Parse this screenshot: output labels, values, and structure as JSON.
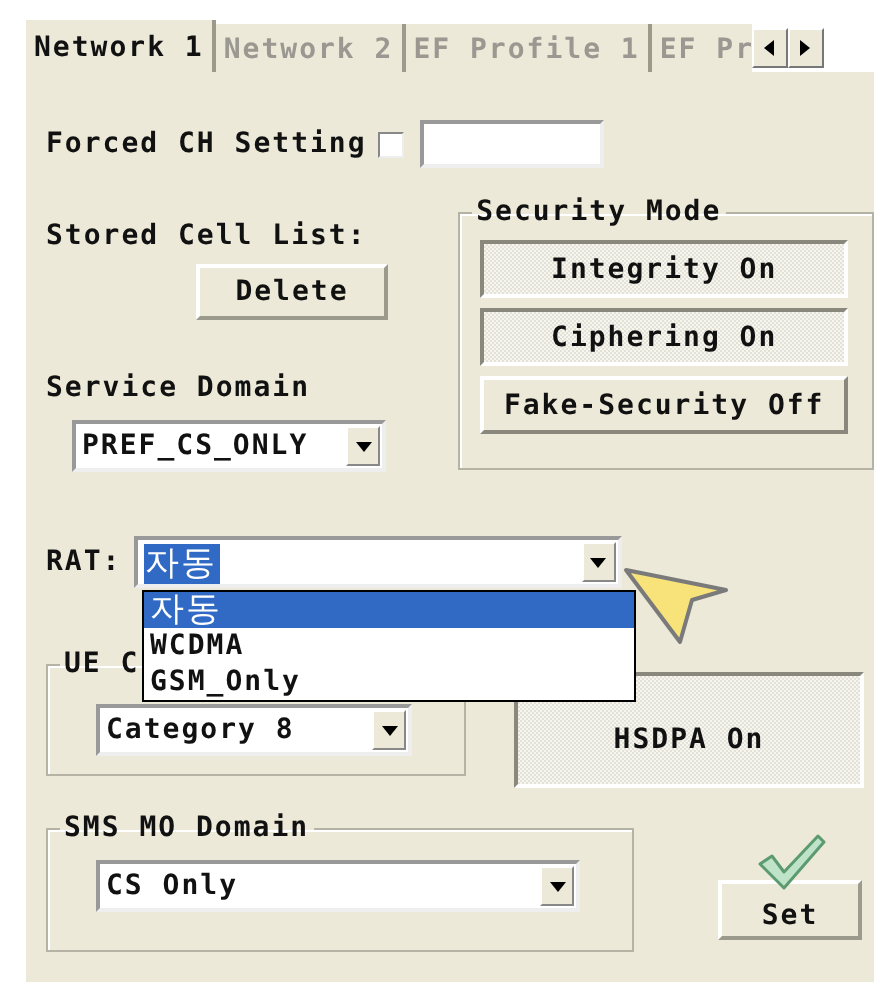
{
  "tabs": [
    {
      "label": "Network 1",
      "selected": true
    },
    {
      "label": "Network 2",
      "selected": false
    },
    {
      "label": "EF Profile 1",
      "selected": false
    },
    {
      "label": "EF Pr",
      "selected": false
    }
  ],
  "forced_ch": {
    "label": "Forced CH Setting",
    "checked": false
  },
  "stored_cell_list": {
    "label": "Stored Cell List:",
    "button": "Delete"
  },
  "service_domain": {
    "label": "Service Domain",
    "value": "PREF_CS_ONLY"
  },
  "security_mode": {
    "title": "Security Mode",
    "buttons": [
      {
        "label": "Integrity On",
        "pressed": true
      },
      {
        "label": "Ciphering On",
        "pressed": true
      },
      {
        "label": "Fake-Security Off",
        "pressed": false
      }
    ]
  },
  "rat": {
    "label": "RAT:",
    "value": "자동",
    "options": [
      {
        "label": "자동",
        "selected": true
      },
      {
        "label": "WCDMA",
        "selected": false
      },
      {
        "label": "GSM_Only",
        "selected": false
      }
    ]
  },
  "ue_category": {
    "title": "UE C",
    "value": "Category 8"
  },
  "hsdpa": {
    "label": "HSDPA On",
    "pressed": true
  },
  "sms_mo_domain": {
    "title": "SMS MO Domain",
    "value": "CS Only"
  },
  "set_button": "Set"
}
